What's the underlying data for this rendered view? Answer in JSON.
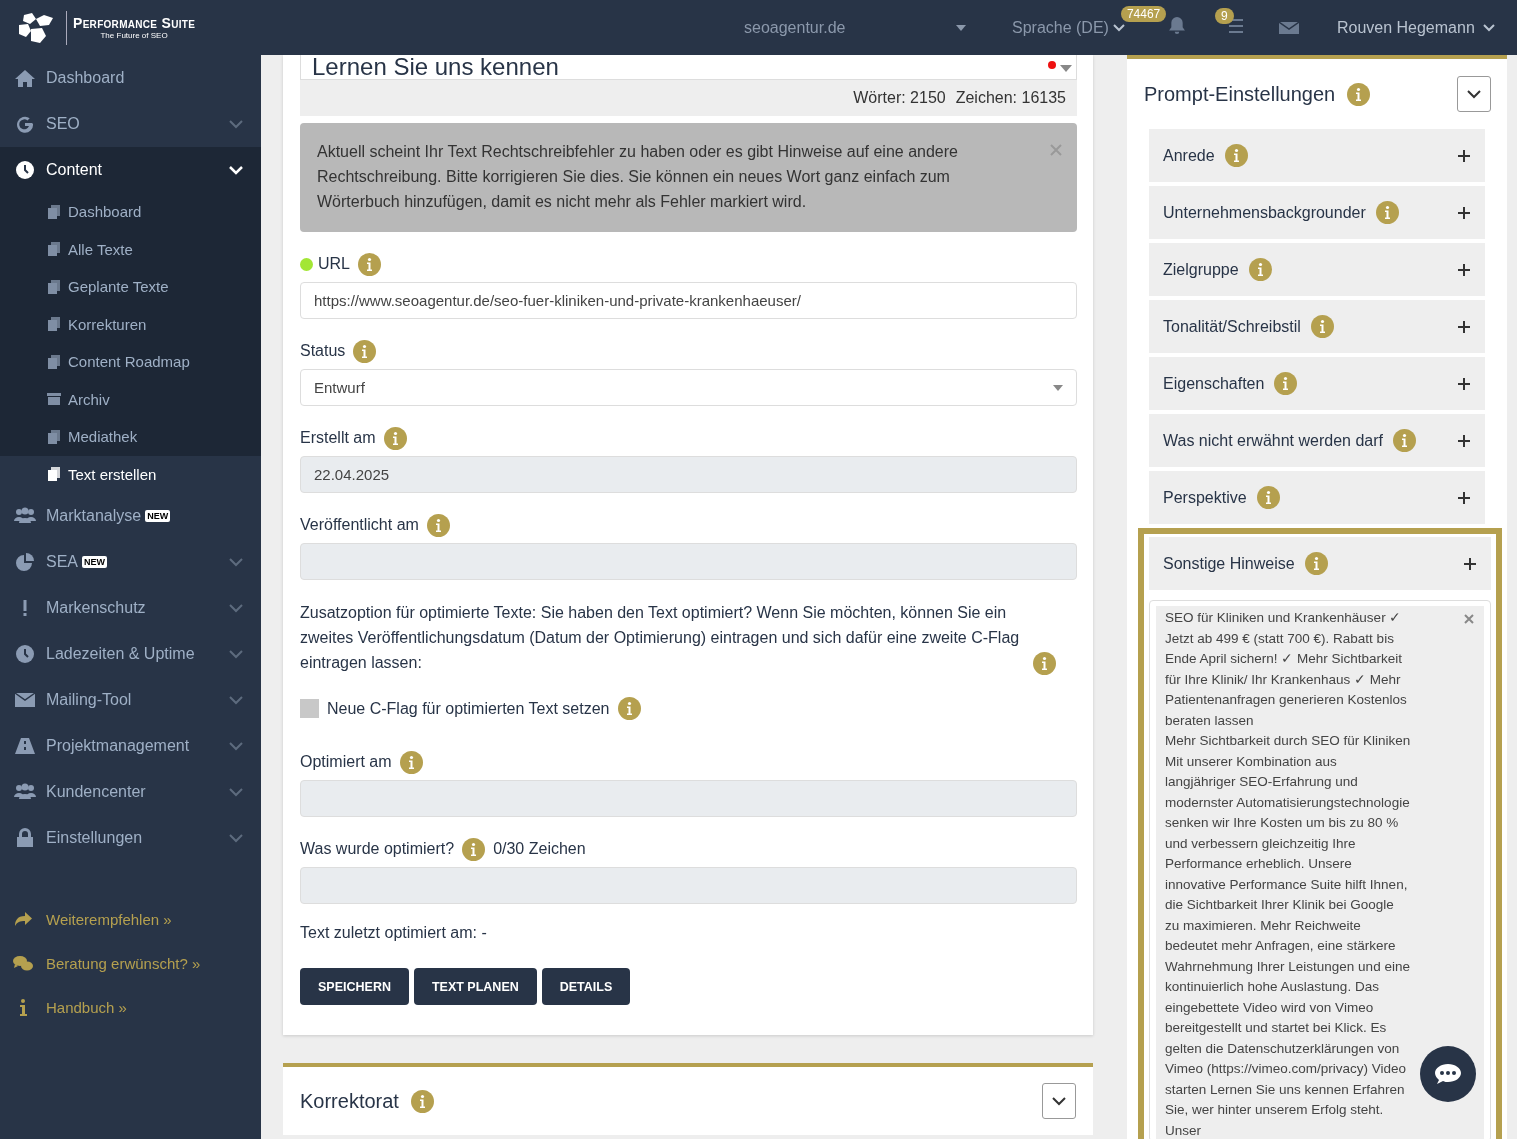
{
  "brand": {
    "title": "Performance Suite",
    "tagline": "The Future of SEO"
  },
  "topbar": {
    "project": "seoagentur.de",
    "language": "Sprache (DE)",
    "notifications_badge": "74467",
    "tasks_badge": "9",
    "user": "Rouven Hegemann"
  },
  "sidebar": {
    "items": [
      {
        "label": "Dashboard",
        "kind": "link",
        "selected": false
      },
      {
        "label": "SEO",
        "kind": "group",
        "expanded": false,
        "selected": false
      },
      {
        "label": "Content",
        "kind": "group",
        "expanded": true,
        "selected": true,
        "children": [
          {
            "label": "Dashboard",
            "selected": false
          },
          {
            "label": "Alle Texte",
            "selected": false
          },
          {
            "label": "Geplante Texte",
            "selected": false
          },
          {
            "label": "Korrekturen",
            "selected": false
          },
          {
            "label": "Content Roadmap",
            "selected": false
          },
          {
            "label": "Archiv",
            "selected": false
          },
          {
            "label": "Mediathek",
            "selected": false
          },
          {
            "label": "Text erstellen",
            "selected": true
          }
        ]
      },
      {
        "label": "Marktanalyse",
        "badge": "NEW",
        "kind": "link",
        "selected": false
      },
      {
        "label": "SEA",
        "badge": "NEW",
        "kind": "group",
        "expanded": false,
        "selected": false
      },
      {
        "label": "Markenschutz",
        "kind": "group",
        "expanded": false,
        "selected": false
      },
      {
        "label": "Ladezeiten & Uptime",
        "kind": "group",
        "expanded": false,
        "selected": false
      },
      {
        "label": "Mailing-Tool",
        "kind": "group",
        "expanded": false,
        "selected": false
      },
      {
        "label": "Projektmanagement",
        "kind": "group",
        "expanded": false,
        "selected": false
      },
      {
        "label": "Kundencenter",
        "kind": "group",
        "expanded": false,
        "selected": false
      },
      {
        "label": "Einstellungen",
        "kind": "group",
        "expanded": false,
        "selected": false
      }
    ],
    "links": [
      "Weiterempfehlen »",
      "Beratung erwünscht? »",
      "Handbuch »"
    ]
  },
  "editor": {
    "title": "Lernen Sie uns kennen",
    "words": "Wörter: 2150",
    "chars": "Zeichen: 16135"
  },
  "alert": "Aktuell scheint Ihr Text Rechtschreibfehler zu haben oder es gibt Hinweise auf eine andere Rechtschreibung. Bitte korrigieren Sie dies. Sie können ein neues Wort ganz einfach zum Wörterbuch hinzufügen, damit es nicht mehr als Fehler markiert wird.",
  "form": {
    "url": {
      "label": "URL",
      "color": "#a3e635",
      "value": "https://www.seoagentur.de/seo-fuer-kliniken-und-private-krankenhaeuser/"
    },
    "status": {
      "label": "Status",
      "value": "Entwurf"
    },
    "created": {
      "label": "Erstellt am",
      "value": "22.04.2025"
    },
    "published": {
      "label": "Veröffentlicht am"
    },
    "note": "Zusatzoption für optimierte Texte: Sie haben den Text optimiert? Wenn Sie möchten, können Sie ein zweites Veröffentlichungsdatum (Datum der Optimierung) eintragen und sich dafür eine zweite C-Flag eintragen lassen:",
    "cflag": {
      "label": "Neue C-Flag für optimierten Text setzen",
      "checked": false
    },
    "optimized": {
      "label": "Optimiert am"
    },
    "what": {
      "label": "Was wurde optimiert?",
      "counter": "0/30 Zeichen"
    },
    "last": "Text zuletzt optimiert am: -",
    "buttons": [
      "SPEICHERN",
      "TEXT PLANEN",
      "DETAILS"
    ]
  },
  "korrektorat": {
    "title": "Korrektorat"
  },
  "prompt": {
    "title": "Prompt-Einstellungen",
    "sections": [
      {
        "label": "Anrede",
        "highlighted": false,
        "expanded": false
      },
      {
        "label": "Unternehmensbackgrounder",
        "highlighted": false,
        "expanded": false
      },
      {
        "label": "Zielgruppe",
        "highlighted": false,
        "expanded": false
      },
      {
        "label": "Tonalität/Schreibstil",
        "highlighted": false,
        "expanded": false
      },
      {
        "label": "Eigenschaften",
        "highlighted": false,
        "expanded": false
      },
      {
        "label": "Was nicht erwähnt werden darf",
        "highlighted": false,
        "expanded": false
      },
      {
        "label": "Perspektive",
        "highlighted": false,
        "expanded": false
      },
      {
        "label": "Sonstige Hinweise",
        "highlighted": true,
        "expanded": true,
        "text": "SEO für Kliniken und Krankenhäuser ✓ Jetzt ab 499 € (statt 700 €). Rabatt bis Ende April sichern! ✓ Mehr Sichtbarkeit für Ihre Klinik/ Ihr Krankenhaus ✓ Mehr Patientenanfragen generieren Kostenlos beraten lassen\nMehr Sichtbarkeit durch SEO für Kliniken Mit unserer Kombination aus langjähriger SEO-Erfahrung und modernster Automatisierungstechnologie senken wir Ihre Kosten um bis zu 80 % und verbessern gleichzeitig Ihre Performance erheblich. Unsere innovative Performance Suite hilft Ihnen, die Sichtbarkeit Ihrer Klinik bei Google zu maximieren. Mehr Reichweite bedeutet mehr Anfragen, eine stärkere Wahrnehmung Ihrer Leistungen und eine kontinuierlich hohe Auslastung. Das eingebettete Video wird von Vimeo bereitgestellt und startet bei Klick. Es gelten die Datenschutzerklärungen von Vimeo (https://vimeo.com/privacy) Video starten Lernen Sie uns kennen Erfahren Sie, wer hinter unserem Erfolg steht. Unser"
      }
    ]
  }
}
